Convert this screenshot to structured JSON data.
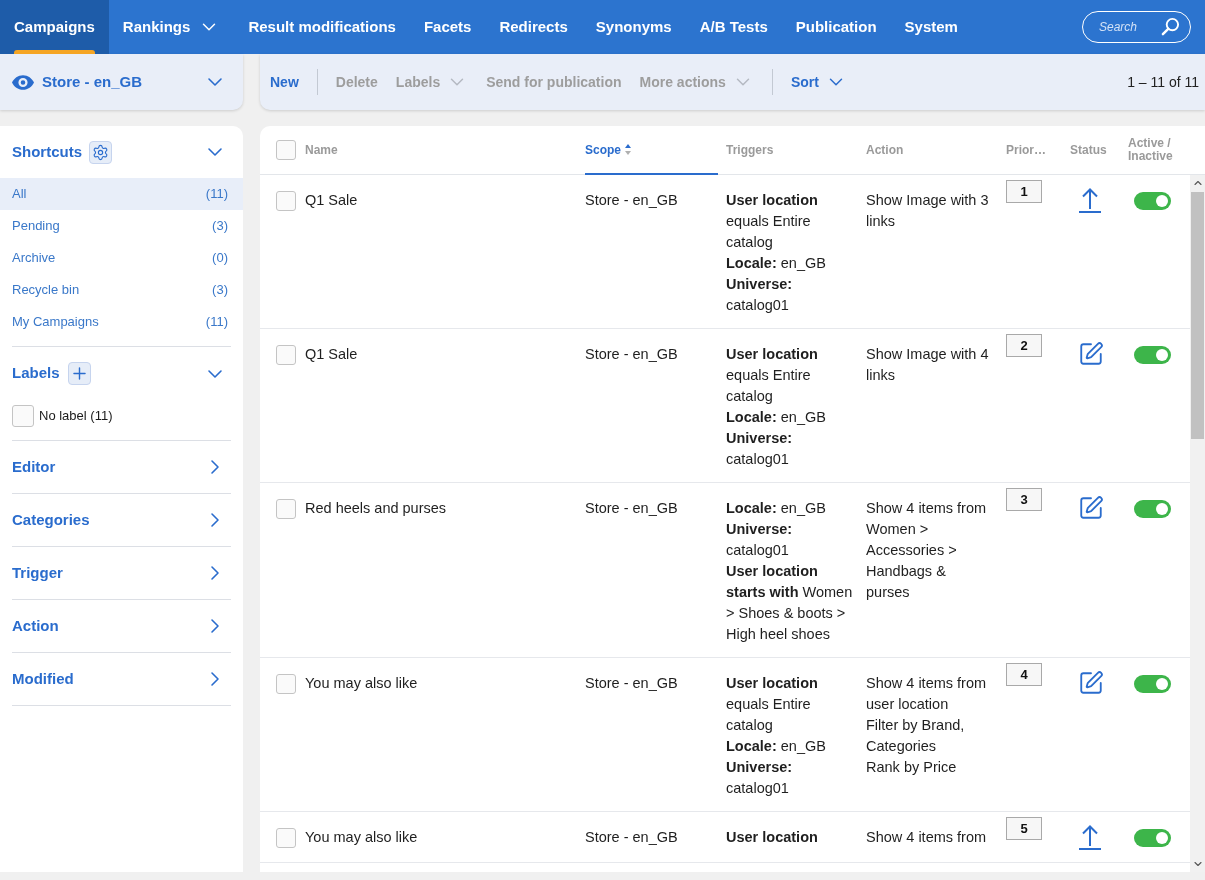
{
  "nav": {
    "tabs": [
      {
        "label": "Campaigns",
        "selected": true,
        "dropdown": false
      },
      {
        "label": "Rankings",
        "selected": false,
        "dropdown": true
      },
      {
        "label": "Result modifications",
        "selected": false,
        "dropdown": false
      },
      {
        "label": "Facets",
        "selected": false,
        "dropdown": false
      },
      {
        "label": "Redirects",
        "selected": false,
        "dropdown": false
      },
      {
        "label": "Synonyms",
        "selected": false,
        "dropdown": false
      },
      {
        "label": "A/B Tests",
        "selected": false,
        "dropdown": false
      },
      {
        "label": "Publication",
        "selected": false,
        "dropdown": false
      },
      {
        "label": "System",
        "selected": false,
        "dropdown": false
      }
    ],
    "search": {
      "placeholder": "Search"
    }
  },
  "scope_selector": {
    "label": "Store - en_GB"
  },
  "toolbar": {
    "groups": [
      [
        {
          "label": "New",
          "disabled": false,
          "dropdown": false
        }
      ],
      [
        {
          "label": "Delete",
          "disabled": true,
          "dropdown": false
        },
        {
          "label": "Labels",
          "disabled": true,
          "dropdown": true
        },
        {
          "label": "Send for publication",
          "disabled": true,
          "dropdown": false
        },
        {
          "label": "More actions",
          "disabled": true,
          "dropdown": true
        }
      ],
      [
        {
          "label": "Sort",
          "disabled": false,
          "dropdown": true
        }
      ]
    ],
    "pagination": "1 – 11 of 11"
  },
  "sidebar": {
    "shortcuts": {
      "title": "Shortcuts",
      "expanded": true,
      "items": [
        {
          "label": "All",
          "count": "(11)",
          "selected": true
        },
        {
          "label": "Pending",
          "count": "(3)",
          "selected": false
        },
        {
          "label": "Archive",
          "count": "(0)",
          "selected": false
        },
        {
          "label": "Recycle bin",
          "count": "(3)",
          "selected": false
        },
        {
          "label": "My Campaigns",
          "count": "(11)",
          "selected": false
        }
      ]
    },
    "labels": {
      "title": "Labels",
      "expanded": true,
      "options": [
        {
          "label": "No label (11)",
          "checked": false
        }
      ]
    },
    "filters": [
      {
        "title": "Editor",
        "expanded": false
      },
      {
        "title": "Categories",
        "expanded": false
      },
      {
        "title": "Trigger",
        "expanded": false
      },
      {
        "title": "Action",
        "expanded": false
      },
      {
        "title": "Modified",
        "expanded": false
      }
    ]
  },
  "table": {
    "select_all": {
      "checked": false
    },
    "columns": [
      {
        "label": "Name",
        "sorted": false
      },
      {
        "label": "Scope",
        "sorted": true
      },
      {
        "label": "Triggers",
        "sorted": false
      },
      {
        "label": "Action",
        "sorted": false
      },
      {
        "label": "Prior…",
        "sorted": false
      },
      {
        "label": "Status",
        "sorted": false
      },
      {
        "label": "Active / Inactive",
        "sorted": false
      }
    ],
    "rows": [
      {
        "name": "Q1 Sale",
        "checked": false,
        "scope": "Store - en_GB",
        "triggers": [
          {
            "label": "User location",
            "value": "equals Entire catalog"
          },
          {
            "label": "Locale:",
            "value": "en_GB"
          },
          {
            "label": "Universe:",
            "value": "catalog01"
          }
        ],
        "action": [
          "Show Image with 3 links"
        ],
        "priority": "1",
        "status": {
          "kind": "publish"
        },
        "active": true
      },
      {
        "name": "Q1 Sale",
        "checked": false,
        "scope": "Store - en_GB",
        "triggers": [
          {
            "label": "User location",
            "value": "equals Entire catalog"
          },
          {
            "label": "Locale:",
            "value": "en_GB"
          },
          {
            "label": "Universe:",
            "value": "catalog01"
          }
        ],
        "action": [
          "Show Image with 4 links"
        ],
        "priority": "2",
        "status": {
          "kind": "edit"
        },
        "active": true
      },
      {
        "name": "Red heels and purses",
        "checked": false,
        "scope": "Store - en_GB",
        "triggers": [
          {
            "label": "Locale:",
            "value": "en_GB"
          },
          {
            "label": "Universe:",
            "value": "catalog01"
          },
          {
            "label": "User location starts with",
            "value": "Women > Shoes & boots > High heel shoes"
          }
        ],
        "action": [
          "Show 4 items from Women > Accessories > Handbags & purses"
        ],
        "priority": "3",
        "status": {
          "kind": "edit"
        },
        "active": true
      },
      {
        "name": "You may also like",
        "checked": false,
        "scope": "Store - en_GB",
        "triggers": [
          {
            "label": "User location",
            "value": "equals Entire catalog"
          },
          {
            "label": "Locale:",
            "value": "en_GB"
          },
          {
            "label": "Universe:",
            "value": "catalog01"
          }
        ],
        "action": [
          "Show 4 items from user location",
          "Filter by Brand, Categories",
          "Rank by Price"
        ],
        "priority": "4",
        "status": {
          "kind": "edit"
        },
        "active": true
      },
      {
        "name": "You may also like",
        "checked": false,
        "scope": "Store - en_GB",
        "triggers": [
          {
            "label": "User location"
          }
        ],
        "action": [
          "Show 4 items from"
        ],
        "priority": "5",
        "status": {
          "kind": "publish"
        },
        "active": true
      }
    ]
  }
}
